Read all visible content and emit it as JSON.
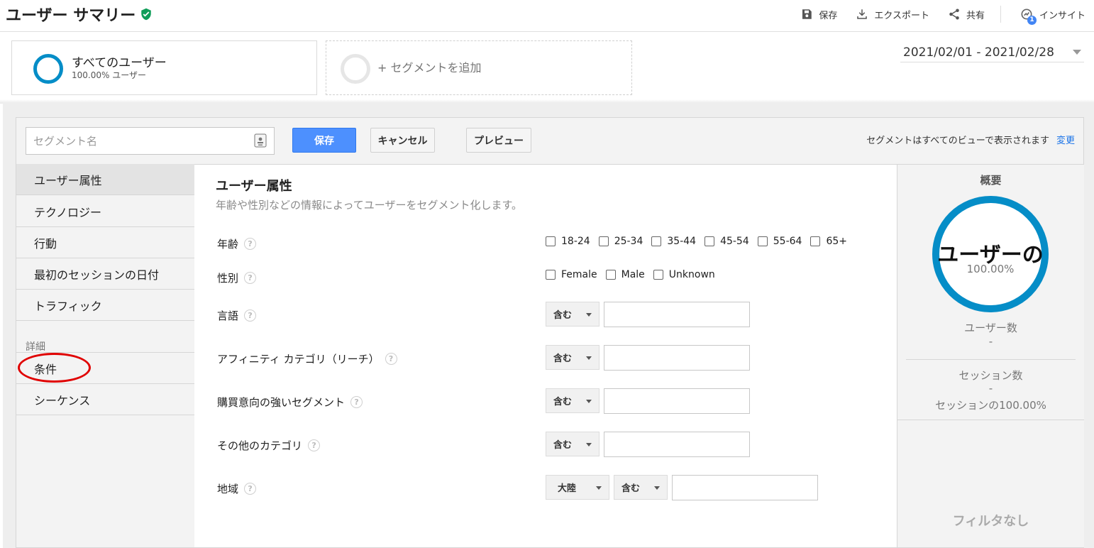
{
  "header": {
    "title": "ユーザー サマリー",
    "toolbar": {
      "save": "保存",
      "export": "エクスポート",
      "share": "共有",
      "insights": "インサイト",
      "insights_badge": "1"
    }
  },
  "segments": {
    "active": {
      "name": "すべてのユーザー",
      "sub": "100.00% ユーザー"
    },
    "add_label": "+ セグメントを追加"
  },
  "date_range": "2021/02/01 - 2021/02/28",
  "editor": {
    "name_placeholder": "セグメント名",
    "save_label": "保存",
    "cancel_label": "キャンセル",
    "preview_label": "プレビュー",
    "visibility_text": "セグメントはすべてのビューで表示されます",
    "visibility_change": "変更"
  },
  "nav": {
    "items": [
      {
        "label": "ユーザー属性"
      },
      {
        "label": "テクノロジー"
      },
      {
        "label": "行動"
      },
      {
        "label": "最初のセッションの日付"
      },
      {
        "label": "トラフィック"
      }
    ],
    "section_label": "詳細",
    "advanced": [
      {
        "label": "条件"
      },
      {
        "label": "シーケンス"
      }
    ]
  },
  "content": {
    "title": "ユーザー属性",
    "desc": "年齢や性別などの情報によってユーザーをセグメント化します。",
    "rows": {
      "age": {
        "label": "年齢",
        "options": [
          "18-24",
          "25-34",
          "35-44",
          "45-54",
          "55-64",
          "65+"
        ]
      },
      "gender": {
        "label": "性別",
        "options": [
          "Female",
          "Male",
          "Unknown"
        ]
      },
      "language": {
        "label": "言語",
        "match": "含む"
      },
      "affinity": {
        "label": "アフィニティ カテゴリ（リーチ）",
        "match": "含む"
      },
      "in_market": {
        "label": "購買意向の強いセグメント",
        "match": "含む"
      },
      "other": {
        "label": "その他のカテゴリ",
        "match": "含む"
      },
      "location": {
        "label": "地域",
        "scope": "大陸",
        "match": "含む"
      }
    },
    "help_glyph": "?"
  },
  "summary": {
    "title": "概要",
    "ring_label": "ユーザーの",
    "ring_pct": "100.00%",
    "users_label": "ユーザー数",
    "users_value": "-",
    "sessions_label": "セッション数",
    "sessions_value": "-",
    "sessions_pct": "セッションの100.00%",
    "no_filter": "フィルタなし"
  },
  "colors": {
    "accent": "#058dc7",
    "primary_button": "#4d90fe",
    "verified": "#0f9d58",
    "annotation": "#e00000"
  }
}
